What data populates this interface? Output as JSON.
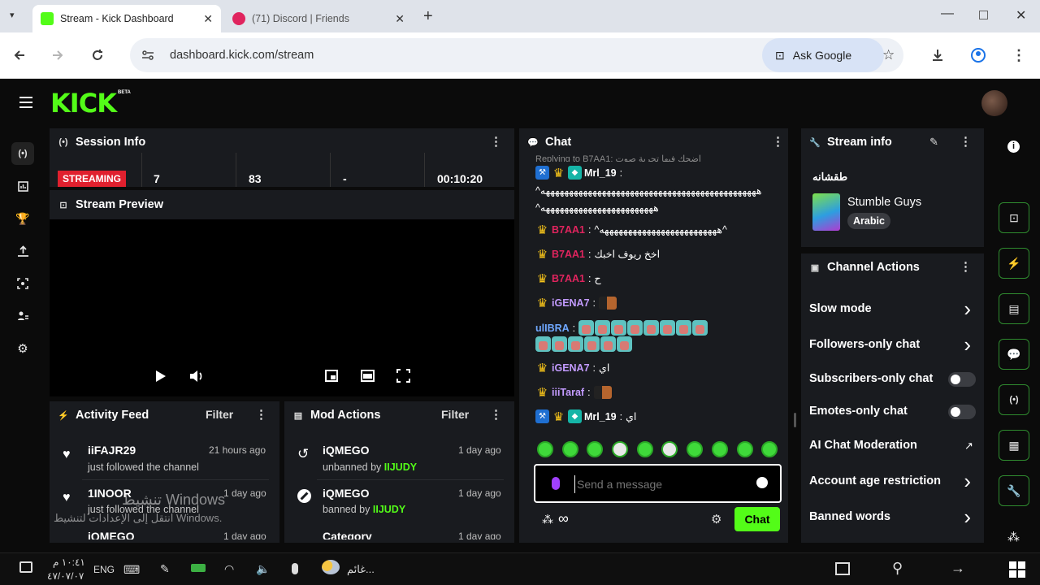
{
  "browser": {
    "tabs": [
      {
        "title": "Stream - Kick Dashboard",
        "active": true,
        "favicon_color": "#53fc18"
      },
      {
        "title": "(71) Discord | Friends",
        "active": false,
        "favicon_color": "#e0245e"
      }
    ],
    "url": "dashboard.kick.com/stream",
    "ask_google": "Ask Google"
  },
  "app": {
    "logo": "KICK",
    "logo_badge": "BETA",
    "accent": "#53fc18"
  },
  "session": {
    "title": "Session Info",
    "status": "STREAMING",
    "stats": [
      "7",
      "83",
      "-",
      "00:10:20"
    ]
  },
  "preview": {
    "title": "Stream Preview"
  },
  "activity": {
    "title": "Activity Feed",
    "filter": "Filter",
    "items": [
      {
        "user": "iiFAJR29",
        "time": "21 hours ago",
        "action": "just followed the channel"
      },
      {
        "user": "1INOOR",
        "time": "1 day ago",
        "action": "just followed the channel"
      },
      {
        "user": "iQMEGO",
        "time": "1 day ago",
        "action": ""
      }
    ]
  },
  "mod": {
    "title": "Mod Actions",
    "filter": "Filter",
    "items": [
      {
        "user": "iQMEGO",
        "time": "1 day ago",
        "action": "unbanned by",
        "by": "IIJUDY"
      },
      {
        "user": "iQMEGO",
        "time": "1 day ago",
        "action": "banned by",
        "by": "IIJUDY"
      },
      {
        "user": "Category",
        "time": "1 day ago",
        "action": "",
        "by": ""
      }
    ]
  },
  "chat": {
    "title": "Chat",
    "reply_hint": "Replying to B7AA1: اضحك فيها تجربة صوت",
    "messages": [
      {
        "user": "Mrl_19",
        "color": "#ffffff",
        "badges": [
          "mod",
          "crown",
          "vip"
        ],
        "text": ""
      },
      {
        "user": "",
        "color": "#ffffff",
        "badges": [],
        "text": "^ههههههههههههههههههههههههههههههههههههههههههههههه"
      },
      {
        "user": "",
        "color": "#ffffff",
        "badges": [],
        "text": "^ههههههههههههههههههههههههه"
      },
      {
        "user": "B7AA1",
        "color": "#e0245e",
        "badges": [
          "crown"
        ],
        "text": "^هههههههههههههههههههههههههه^"
      },
      {
        "user": "B7AA1",
        "color": "#e0245e",
        "badges": [
          "crown"
        ],
        "text": "اخخ ريوف اخبك"
      },
      {
        "user": "B7AA1",
        "color": "#e0245e",
        "badges": [
          "crown"
        ],
        "text": "ح"
      },
      {
        "user": "iGENA7",
        "color": "#c39bff",
        "badges": [
          "crown"
        ],
        "text": ""
      },
      {
        "user": "ulIBRA",
        "color": "#6fa8ff",
        "badges": [],
        "text": ""
      },
      {
        "user": "iGENA7",
        "color": "#c39bff",
        "badges": [
          "crown"
        ],
        "text": "اي"
      },
      {
        "user": "iiiTaraf",
        "color": "#c39bff",
        "badges": [
          "crown"
        ],
        "text": ""
      },
      {
        "user": "Mrl_19",
        "color": "#ffffff",
        "badges": [
          "mod",
          "crown",
          "vip"
        ],
        "text": "اي"
      }
    ],
    "placeholder": "Send a message",
    "send": "Chat"
  },
  "stream_info": {
    "title": "Stream info",
    "stream_title": "طقشانه",
    "category": "Stumble Guys",
    "language": "Arabic"
  },
  "channel_actions": {
    "title": "Channel Actions",
    "items": [
      {
        "label": "Slow mode",
        "control": "chevron"
      },
      {
        "label": "Followers-only chat",
        "control": "chevron"
      },
      {
        "label": "Subscribers-only chat",
        "control": "toggle"
      },
      {
        "label": "Emotes-only chat",
        "control": "toggle"
      },
      {
        "label": "AI Chat Moderation",
        "control": "external"
      },
      {
        "label": "Account age restriction",
        "control": "chevron"
      },
      {
        "label": "Banned words",
        "control": "chevron"
      }
    ]
  },
  "watermark": {
    "line1": "تنشيط Windows",
    "line2": "انتقل إلى الإعدادات لتنشيط Windows."
  },
  "taskbar": {
    "time": "١٠:٤١ م",
    "date": "٤٧/٠٧/٠٧",
    "lang": "ENG",
    "weather": "غائم..."
  }
}
